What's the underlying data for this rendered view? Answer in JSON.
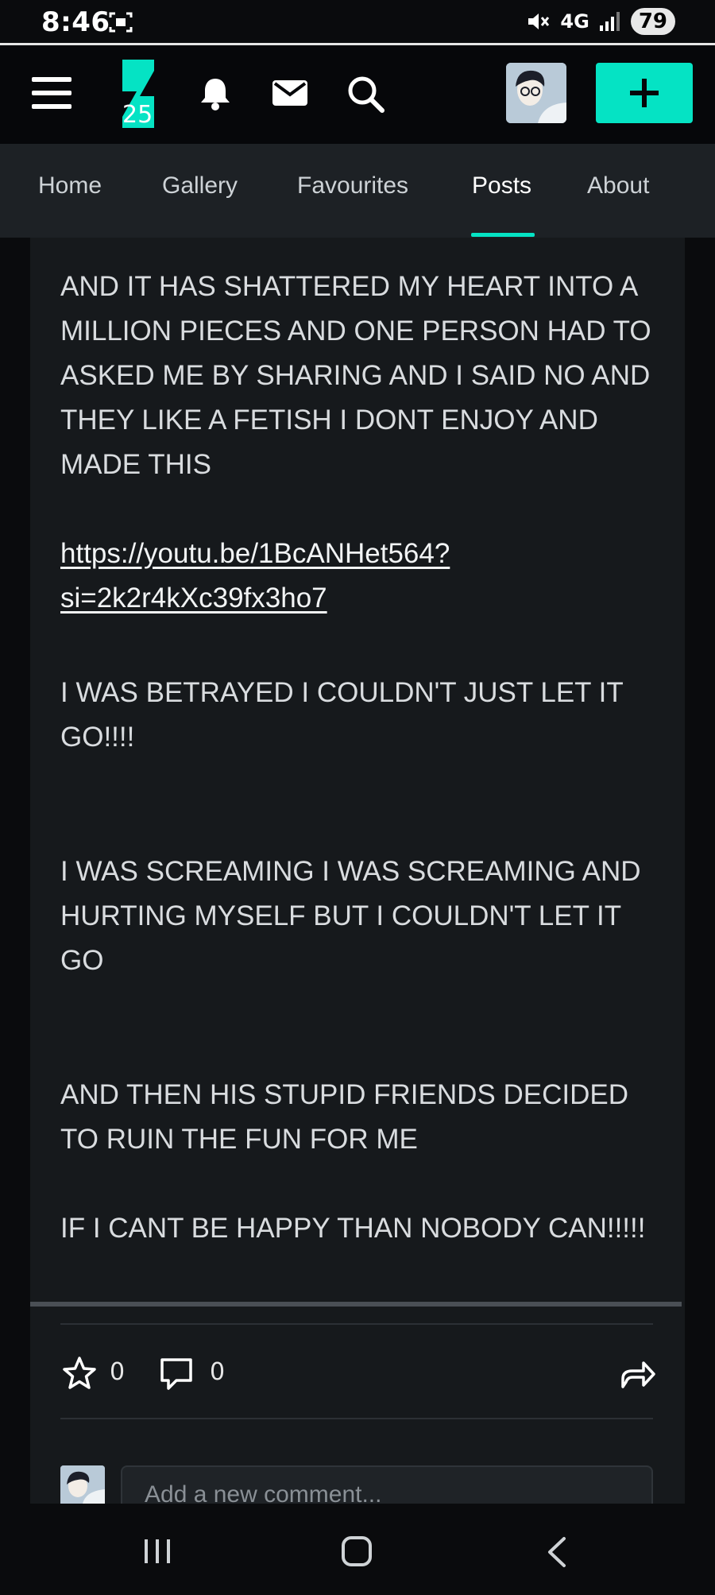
{
  "status_bar": {
    "time": "8:46",
    "network": "4G",
    "battery": "79"
  },
  "header": {
    "logo_badge": "25",
    "accent_color": "#05e3c4"
  },
  "tabs": [
    {
      "label": "Home"
    },
    {
      "label": "Gallery"
    },
    {
      "label": "Favourites"
    },
    {
      "label": "Posts",
      "active": true
    },
    {
      "label": "About"
    }
  ],
  "post": {
    "paragraphs": [
      "AND IT HAS SHATTERED MY HEART INTO A MILLION PIECES AND ONE PERSON HAD TO ASKED ME BY SHARING AND I SAID NO AND THEY LIKE A FETISH I DONT ENJOY AND MADE THIS",
      "I WAS BETRAYED I COULDN'T JUST LET IT GO!!!!",
      "I WAS SCREAMING I WAS SCREAMING AND HURTING MYSELF BUT I COULDN'T LET IT GO",
      "AND THEN HIS STUPID FRIENDS DECIDED TO RUIN THE FUN FOR ME",
      "IF I CANT BE HAPPY THAN NOBODY CAN!!!!!"
    ],
    "link_line1": "https://youtu.be/1BcANHet564?",
    "link_line2": "si=2k2r4kXc39fx3ho7"
  },
  "actions": {
    "favourites_count": "0",
    "comments_count": "0"
  },
  "comment_box": {
    "placeholder": "Add a new comment..."
  }
}
